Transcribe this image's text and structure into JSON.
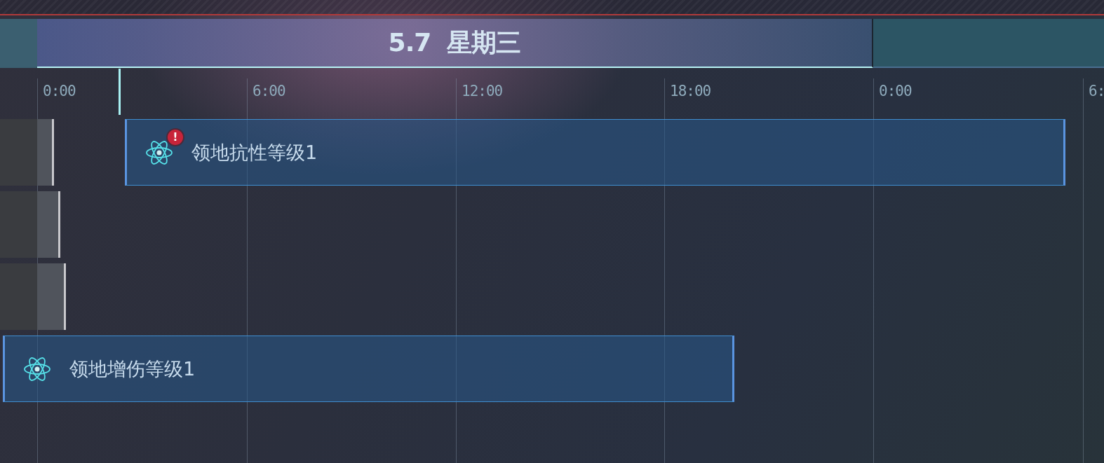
{
  "days": [
    {
      "selected": false
    },
    {
      "label": "5.7  星期三",
      "selected": true
    },
    {
      "selected": false
    }
  ],
  "ticks": [
    "0:00",
    "6:00",
    "12:00",
    "18:00",
    "0:00",
    "6:"
  ],
  "events": [
    {
      "title": "领地抗性等级1",
      "badge": "!"
    },
    {
      "title": "领地增伤等级1"
    }
  ]
}
